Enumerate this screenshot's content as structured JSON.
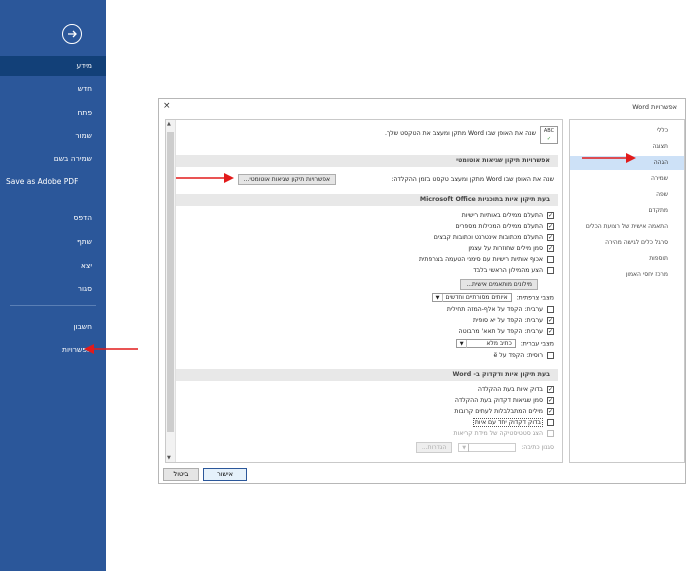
{
  "sidebar": {
    "items": [
      {
        "label": "מידע"
      },
      {
        "label": "חדש"
      },
      {
        "label": "פתח"
      },
      {
        "label": "שמור"
      },
      {
        "label": "שמירה בשם"
      },
      {
        "label": "Save as Adobe PDF"
      },
      {
        "label": "הדפס"
      },
      {
        "label": "שתף"
      },
      {
        "label": "יצא"
      },
      {
        "label": "סגור"
      },
      {
        "label": "חשבון"
      },
      {
        "label": "אפשרויות"
      }
    ]
  },
  "dialog": {
    "title": "אפשרויות Word",
    "close": "×",
    "categories": [
      "כללי",
      "תצוגה",
      "הגהה",
      "שמירה",
      "שפה",
      "מתקדם",
      "התאמה אישית של רצועת הכלים",
      "סרגל כלים לגישה מהירה",
      "תוספות",
      "מרכז יחסי האמון"
    ],
    "active_category": "הגהה",
    "intro": "שנה את האופן שבו Word מתקן ומעצב את הטקסט שלך.",
    "autocorrect": {
      "header": "אפשרויות תיקון שגיאות אוטומטי",
      "text": "שנה את האופן שבו Word מתקן ומעצב טקסט בזמן ההקלדה:",
      "button": "אפשרויות תיקון שגיאות אוטומטי..."
    },
    "office": {
      "header": "בעת תיקון איות בתוכניות Microsoft Office",
      "options": [
        {
          "label": "התעלם ממילים באותיות רישיות",
          "checked": true
        },
        {
          "label": "התעלם ממילים המכילות מספרים",
          "checked": true
        },
        {
          "label": "התעלם מכתובות אינטרנט וכתובות קבצים",
          "checked": true
        },
        {
          "label": "סמן מילים שחוזרות על עצמן",
          "checked": true
        },
        {
          "label": "אכוף אותיות רישיות עם סימני הטעמה בצרפתית",
          "checked": false
        },
        {
          "label": "הצע מהמילון הראשי בלבד",
          "checked": false
        }
      ],
      "dictionaries_button": "מילונים מותאמים אישית...",
      "french_label": "מצבי צרפתית:",
      "french_value": "איותים מסורתיים וחדשים",
      "hebrew_options": [
        {
          "label": "ערבית: הקפד על אלף-המזה תחילית",
          "checked": false
        },
        {
          "label": "ערבית: הקפד על יא סופית",
          "checked": true
        },
        {
          "label": "ערבית: הקפד על תאא' מרבוטה",
          "checked": true
        }
      ],
      "hebrew_label": "מצבי עברית:",
      "hebrew_value": "כתיב מלא",
      "russian": {
        "label": "רוסית: הקפד על ë",
        "checked": false
      }
    },
    "word": {
      "header": "בעת תיקון איות ודקדוק ב- Word",
      "options": [
        {
          "label": "בדוק איות בעת ההקלדה",
          "checked": true
        },
        {
          "label": "סמן שגיאות דקדוק בעת ההקלדה",
          "checked": true
        },
        {
          "label": "מילים המתבלבלות לעתים קרובות",
          "checked": true
        },
        {
          "label": "בדוק דקדוק יחד עם איות",
          "checked": false
        },
        {
          "label": "הצג סטטיסטיקה של מידת קריאות",
          "checked": false,
          "disabled": true
        }
      ],
      "writing_style_label": "סגנון כתיבה:",
      "settings_button": "הגדרות..."
    },
    "ok": "אישור",
    "cancel": "ביטול"
  },
  "colors": {
    "sidebar": "#2b579a",
    "selected": "#124078",
    "arrow": "#e21b1b"
  }
}
